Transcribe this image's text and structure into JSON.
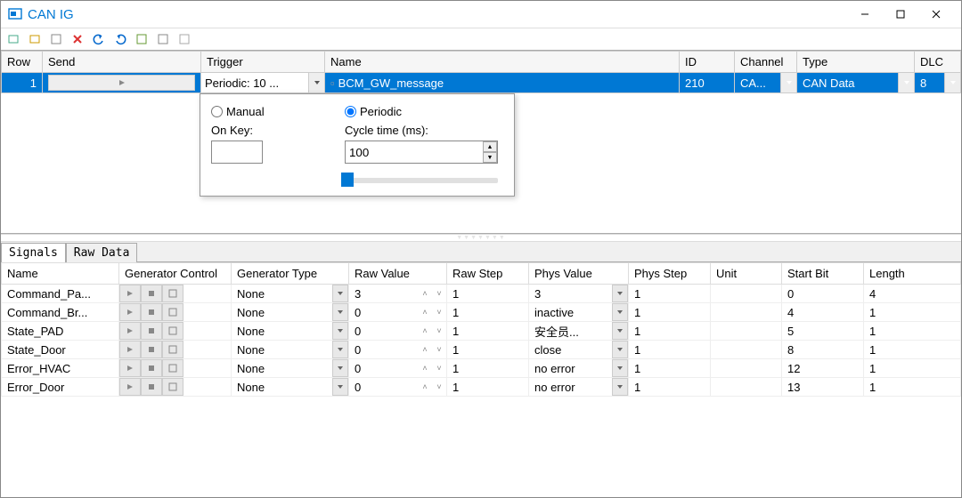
{
  "window": {
    "title": "CAN IG"
  },
  "grid": {
    "headers": [
      "Row",
      "Send",
      "Trigger",
      "Name",
      "ID",
      "Channel",
      "Type",
      "DLC"
    ],
    "row": {
      "row": "1",
      "trigger": "Periodic: 10 ...",
      "name": "BCM_GW_message",
      "id": "210",
      "channel": "CA...",
      "type": "CAN Data",
      "dlc": "8"
    }
  },
  "popup": {
    "manual": "Manual",
    "periodic": "Periodic",
    "onkey_label": "On Key:",
    "onkey_value": "",
    "cycle_label": "Cycle time (ms):",
    "cycle_value": "100"
  },
  "tabs": {
    "signals": "Signals",
    "rawdata": "Raw Data"
  },
  "sig": {
    "headers": [
      "Name",
      "Generator Control",
      "Generator Type",
      "Raw Value",
      "Raw Step",
      "Phys Value",
      "Phys Step",
      "Unit",
      "Start Bit",
      "Length"
    ],
    "rows": [
      {
        "name": "Command_Pa...",
        "gtype": "None",
        "raw": "3",
        "rawstep": "1",
        "phys": "3",
        "physstep": "1",
        "unit": "",
        "start": "0",
        "len": "4"
      },
      {
        "name": "Command_Br...",
        "gtype": "None",
        "raw": "0",
        "rawstep": "1",
        "phys": "inactive",
        "physstep": "1",
        "unit": "",
        "start": "4",
        "len": "1"
      },
      {
        "name": "State_PAD",
        "gtype": "None",
        "raw": "0",
        "rawstep": "1",
        "phys": "安全员...",
        "physstep": "1",
        "unit": "",
        "start": "5",
        "len": "1"
      },
      {
        "name": "State_Door",
        "gtype": "None",
        "raw": "0",
        "rawstep": "1",
        "phys": "close",
        "physstep": "1",
        "unit": "",
        "start": "8",
        "len": "1"
      },
      {
        "name": "Error_HVAC",
        "gtype": "None",
        "raw": "0",
        "rawstep": "1",
        "phys": "no error",
        "physstep": "1",
        "unit": "",
        "start": "12",
        "len": "1"
      },
      {
        "name": "Error_Door",
        "gtype": "None",
        "raw": "0",
        "rawstep": "1",
        "phys": "no error",
        "physstep": "1",
        "unit": "",
        "start": "13",
        "len": "1"
      }
    ]
  }
}
